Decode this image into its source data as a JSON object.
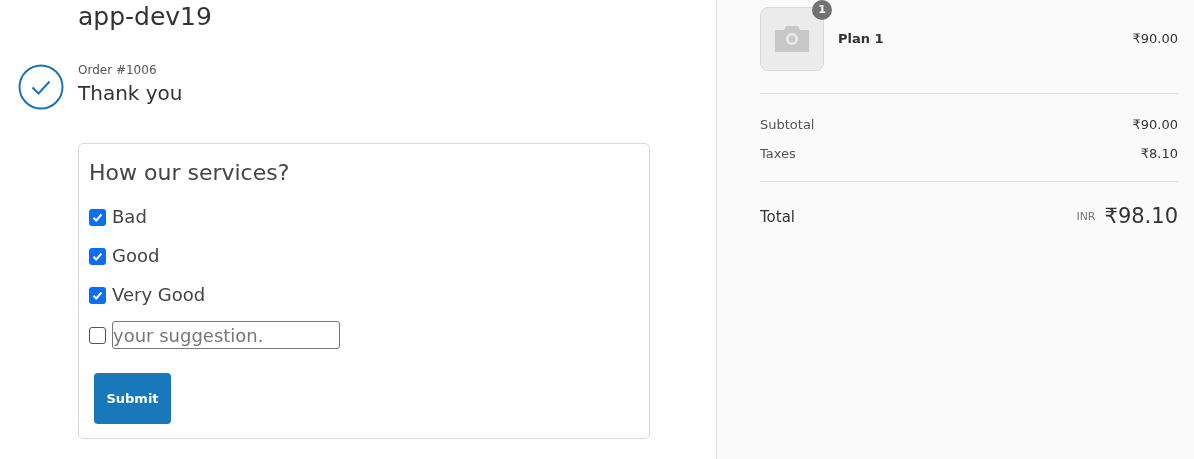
{
  "shop_name": "app-dev19",
  "order": {
    "number": "Order #1006",
    "message": "Thank you",
    "confirmed": true
  },
  "survey": {
    "question": "How our services?",
    "options": [
      {
        "kind": "checkbox",
        "label": "Bad",
        "checked": true
      },
      {
        "kind": "checkbox",
        "label": "Good",
        "checked": true
      },
      {
        "kind": "checkbox",
        "label": "Very Good",
        "checked": true
      },
      {
        "kind": "text-input",
        "placeholder": "your suggestion.",
        "checked": false
      }
    ],
    "submit": "Submit"
  },
  "summary": {
    "items": [
      {
        "name": "Plan 1",
        "quantity": "1",
        "price": "₹90.00"
      }
    ],
    "lines": [
      {
        "label": "Subtotal",
        "value": "₹90.00"
      },
      {
        "label": "Taxes",
        "value": "₹8.10"
      }
    ],
    "total": {
      "label": "Total",
      "currency": "INR",
      "value": "₹98.10"
    }
  }
}
